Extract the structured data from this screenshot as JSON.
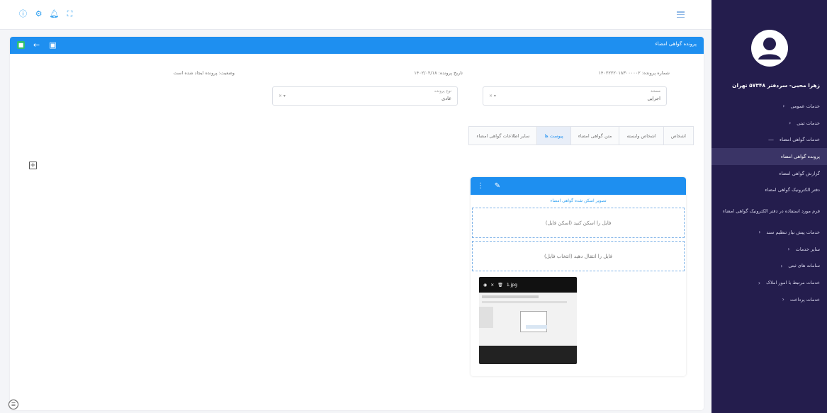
{
  "topbar": {
    "icons": [
      "info-icon",
      "gear-icon",
      "bell-icon",
      "fullscreen-icon"
    ],
    "menu_icon": "hamburger-icon"
  },
  "sidebar": {
    "user_name": "زهرا محبی- سردفتر ۵۷۳۴۸ تهران",
    "items": [
      {
        "label": "خدمات عمومی",
        "arrow": "‹"
      },
      {
        "label": "خدمات ثبتی",
        "arrow": "‹"
      },
      {
        "label": "خدمات گواهی امضاء",
        "arrow": "—"
      },
      {
        "label": "پرونده گواهی امضاء",
        "arrow": ""
      },
      {
        "label": "گزارش گواهی امضاء",
        "arrow": ""
      },
      {
        "label": "دفتر الکترونیک گواهی امضاء",
        "arrow": ""
      },
      {
        "label": "فرم مورد استفاده در دفتر الکترونیک گواهی امضاء",
        "arrow": ""
      },
      {
        "label": "خدمات پیش نیاز تنظیم سند",
        "arrow": "‹"
      },
      {
        "label": "سایر خدمات",
        "arrow": "‹"
      },
      {
        "label": "سامانه های ثبتی",
        "arrow": "‹"
      },
      {
        "label": "خدمات مرتبط با امور املاک",
        "arrow": "‹"
      },
      {
        "label": "خدمات پرداخت",
        "arrow": "‹"
      }
    ]
  },
  "card": {
    "title": "پرونده گواهی امضاء",
    "header_icons": [
      "save-icon",
      "back-arrow-icon",
      "document-icon"
    ]
  },
  "info": {
    "file_number": "شماره پرونده: ۱۴۰۲۲۲۲۰۱۸۳۰۰۰۰۰۲",
    "file_date": "تاریخ پرونده: ۱۴۰۲/۰۲/۱۸",
    "status": "وضعیت: پرونده ایجاد شده است"
  },
  "fields": {
    "field1_label": "مستند",
    "field1_value": "اجرایی",
    "field2_label": "نوع پرونده",
    "field2_value": "عادی"
  },
  "tabs": [
    {
      "label": "اشخاص",
      "active": false
    },
    {
      "label": "اشخاص وابسته",
      "active": false
    },
    {
      "label": "متن گواهی امضاء",
      "active": false
    },
    {
      "label": "پیوست ها",
      "active": true
    },
    {
      "label": "سایر اطلاعات گواهی امضاء",
      "active": false
    }
  ],
  "attachment": {
    "title": "تصویر اسکن شده گواهی امضاء",
    "drop_scan": "فایل را اسکن کنید (اسکن فایل)",
    "drop_upload": "فایل را انتقال دهید (انتخاب فایل)",
    "thumb_name": "1.jpg"
  },
  "colors": {
    "primary": "#1e8ff0",
    "sidebar": "#241d4d",
    "save": "#2fbf71"
  }
}
